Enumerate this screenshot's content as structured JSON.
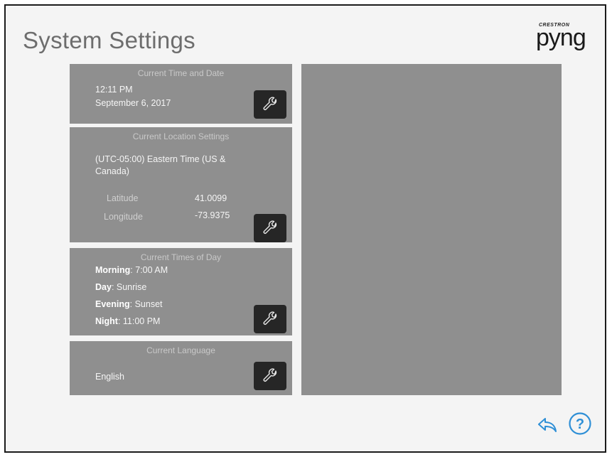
{
  "header": {
    "title": "System Settings",
    "logo_small": "CRESTRON",
    "logo_big": "pyng"
  },
  "cards": {
    "time_date": {
      "title": "Current Time and Date",
      "time": "12:11 PM",
      "date": "September 6, 2017",
      "button_icon": "wrench-icon"
    },
    "location": {
      "title": "Current Location Settings",
      "timezone": "(UTC-05:00) Eastern Time (US & Canada)",
      "latitude_label": "Latitude",
      "latitude_value": "41.0099",
      "longitude_label": "Longitude",
      "longitude_value": "-73.9375",
      "button_icon": "wrench-icon"
    },
    "times_of_day": {
      "title": "Current Times of Day",
      "items": [
        {
          "label": "Morning",
          "sep": ": ",
          "value": "7:00 AM"
        },
        {
          "label": "Day",
          "sep": ": ",
          "value": "Sunrise"
        },
        {
          "label": "Evening",
          "sep": ": ",
          "value": "Sunset"
        },
        {
          "label": "Night",
          "sep": ": ",
          "value": "11:00 PM"
        }
      ],
      "button_icon": "wrench-icon"
    },
    "language": {
      "title": "Current Language",
      "value": "English",
      "button_icon": "wrench-icon"
    }
  },
  "footer": {
    "back_icon": "back-arrow-icon",
    "help_icon": "help-icon",
    "help_glyph": "?",
    "accent_color": "#2e8fd6"
  },
  "colors": {
    "background": "#f4f4f4",
    "card": "#8f8f8f",
    "button": "#262626"
  }
}
